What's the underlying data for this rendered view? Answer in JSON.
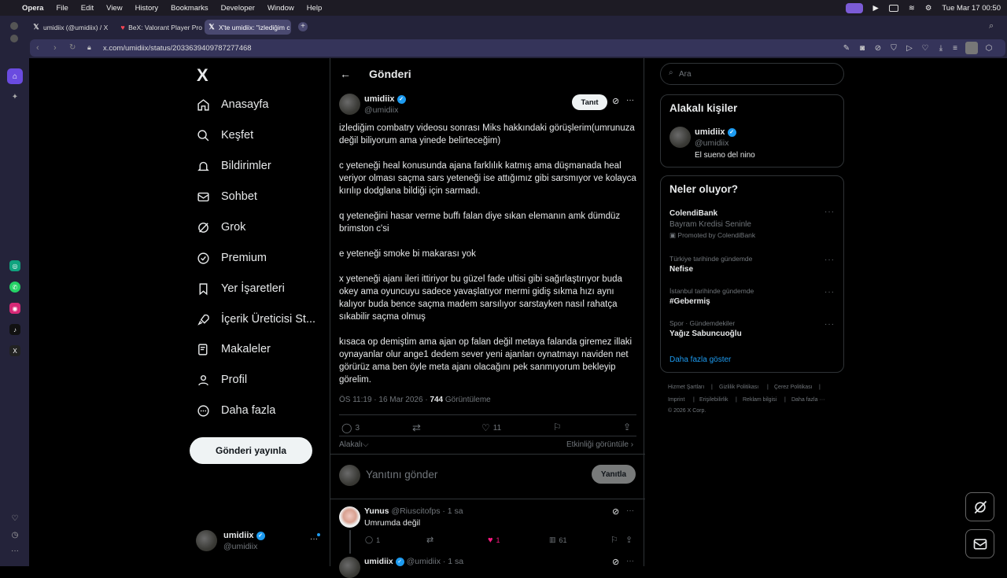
{
  "menubar": {
    "app": "Opera",
    "items": [
      "File",
      "Edit",
      "View",
      "History",
      "Bookmarks",
      "Developer",
      "Window",
      "Help"
    ],
    "clock": "Tue Mar 17  00:50"
  },
  "tabs": [
    {
      "label": "umidiix (@umidiix) / X",
      "icon": "x-logo-icon"
    },
    {
      "label": "BeX: Valorant Player Pro",
      "icon": "valorant-icon"
    },
    {
      "label": "X'te umidiix: \"izlediğim c",
      "icon": "x-logo-icon"
    }
  ],
  "address": {
    "url": "x.com/umidiix/status/2033639409787277468"
  },
  "nav": {
    "logo": "X",
    "items": [
      {
        "label": "Anasayfa",
        "icon": "home-icon"
      },
      {
        "label": "Keşfet",
        "icon": "search-icon"
      },
      {
        "label": "Bildirimler",
        "icon": "bell-icon"
      },
      {
        "label": "Sohbet",
        "icon": "mail-icon"
      },
      {
        "label": "Grok",
        "icon": "grok-icon"
      },
      {
        "label": "Premium",
        "icon": "premium-icon"
      },
      {
        "label": "Yer İşaretleri",
        "icon": "bookmark-icon"
      },
      {
        "label": "İçerik Üreticisi St...",
        "icon": "rocket-icon"
      },
      {
        "label": "Makaleler",
        "icon": "article-icon"
      },
      {
        "label": "Profil",
        "icon": "profile-icon"
      },
      {
        "label": "Daha fazla",
        "icon": "more-circle-icon"
      }
    ],
    "post_button": "Gönderi yayınla",
    "account": {
      "name": "umidiix",
      "handle": "@umidiix"
    }
  },
  "post": {
    "header_title": "Gönderi",
    "author": "umidiix",
    "handle": "@umidiix",
    "follow_button": "Tanıt",
    "paragraphs": [
      "izlediğim combatry videosu sonrası Miks hakkındaki görüşlerim(umrunuza değil biliyorum ama yinede belirteceğim)",
      "c yeteneği heal konusunda ajana farklılık katmış ama düşmanada heal veriyor olması saçma sars yeteneği ise attığımız gibi sarsmıyor ve kolayca kırılıp dodglana bildiği için sarmadı.",
      "q yeteneğini hasar verme buffı falan diye sıkan elemanın amk dümdüz brimston c'si",
      "e yeteneği smoke bi makarası yok",
      "x yeteneği ajanı ileri ittiriyor bu güzel fade ultisi gibi sağırlaştırıyor buda okey ama oyuncuyu sadece yavaşlatıyor mermi gidiş sıkma hızı aynı kalıyor buda bence saçma madem sarsılıyor sarstayken nasıl rahatça sıkabilir saçma olmuş",
      "kısaca op demiştim ama ajan op falan değil metaya falanda giremez illaki oynayanlar olur ange1 dedem sever yeni ajanları oynatmayı naviden net görürüz ama ben öyle meta ajanı olacağını pek sanmıyorum bekleyip görelim."
    ],
    "time": "ÖS 11:19 · 16 Mar 2026 · ",
    "views_count": "744",
    "views_label": "Görüntüleme",
    "replies": "3",
    "likes": "11",
    "relevance": "Alakalı",
    "activity": "Etkinliği görüntüle",
    "reply_placeholder": "Yanıtını gönder",
    "reply_button": "Yanıtla"
  },
  "replies": [
    {
      "name": "Yunus",
      "handle": "@Riuscitofps",
      "time": "· 1 sa",
      "text": "Umrumda değil",
      "replies": "1",
      "likes": "1",
      "views": "61"
    },
    {
      "name": "umidiix",
      "handle": "@umidiix",
      "time": "· 1 sa"
    }
  ],
  "sidebar": {
    "search_placeholder": "Ara",
    "related_title": "Alakalı kişiler",
    "related": {
      "name": "umidiix",
      "handle": "@umidiix",
      "bio": "El sueno del nino"
    },
    "trends_title": "Neler oluyor?",
    "promo": {
      "name": "ColendiBank",
      "desc": "Bayram Kredisi Seninle",
      "promoted": "Promoted by ColendiBank"
    },
    "trends": [
      {
        "cat": "Türkiye tarihinde gündemde",
        "name": "Nefise"
      },
      {
        "cat": "İstanbul tarihinde gündemde",
        "name": "#Gebermiş"
      },
      {
        "cat": "Spor · Gündemdekiler",
        "name": "Yağız Sabuncuoğlu"
      }
    ],
    "show_more": "Daha fazla göster",
    "footer": [
      "Hizmet Şartları",
      "Gizlilik Politikası",
      "Çerez Politikası",
      "Imprint",
      "Erişilebilirlik",
      "Reklam bilgisi",
      "Daha fazla ···",
      "© 2026 X Corp."
    ]
  },
  "colors": {
    "accent": "#1d9bf0",
    "like": "#f91880",
    "bg": "#000000",
    "border": "#2f3336"
  }
}
